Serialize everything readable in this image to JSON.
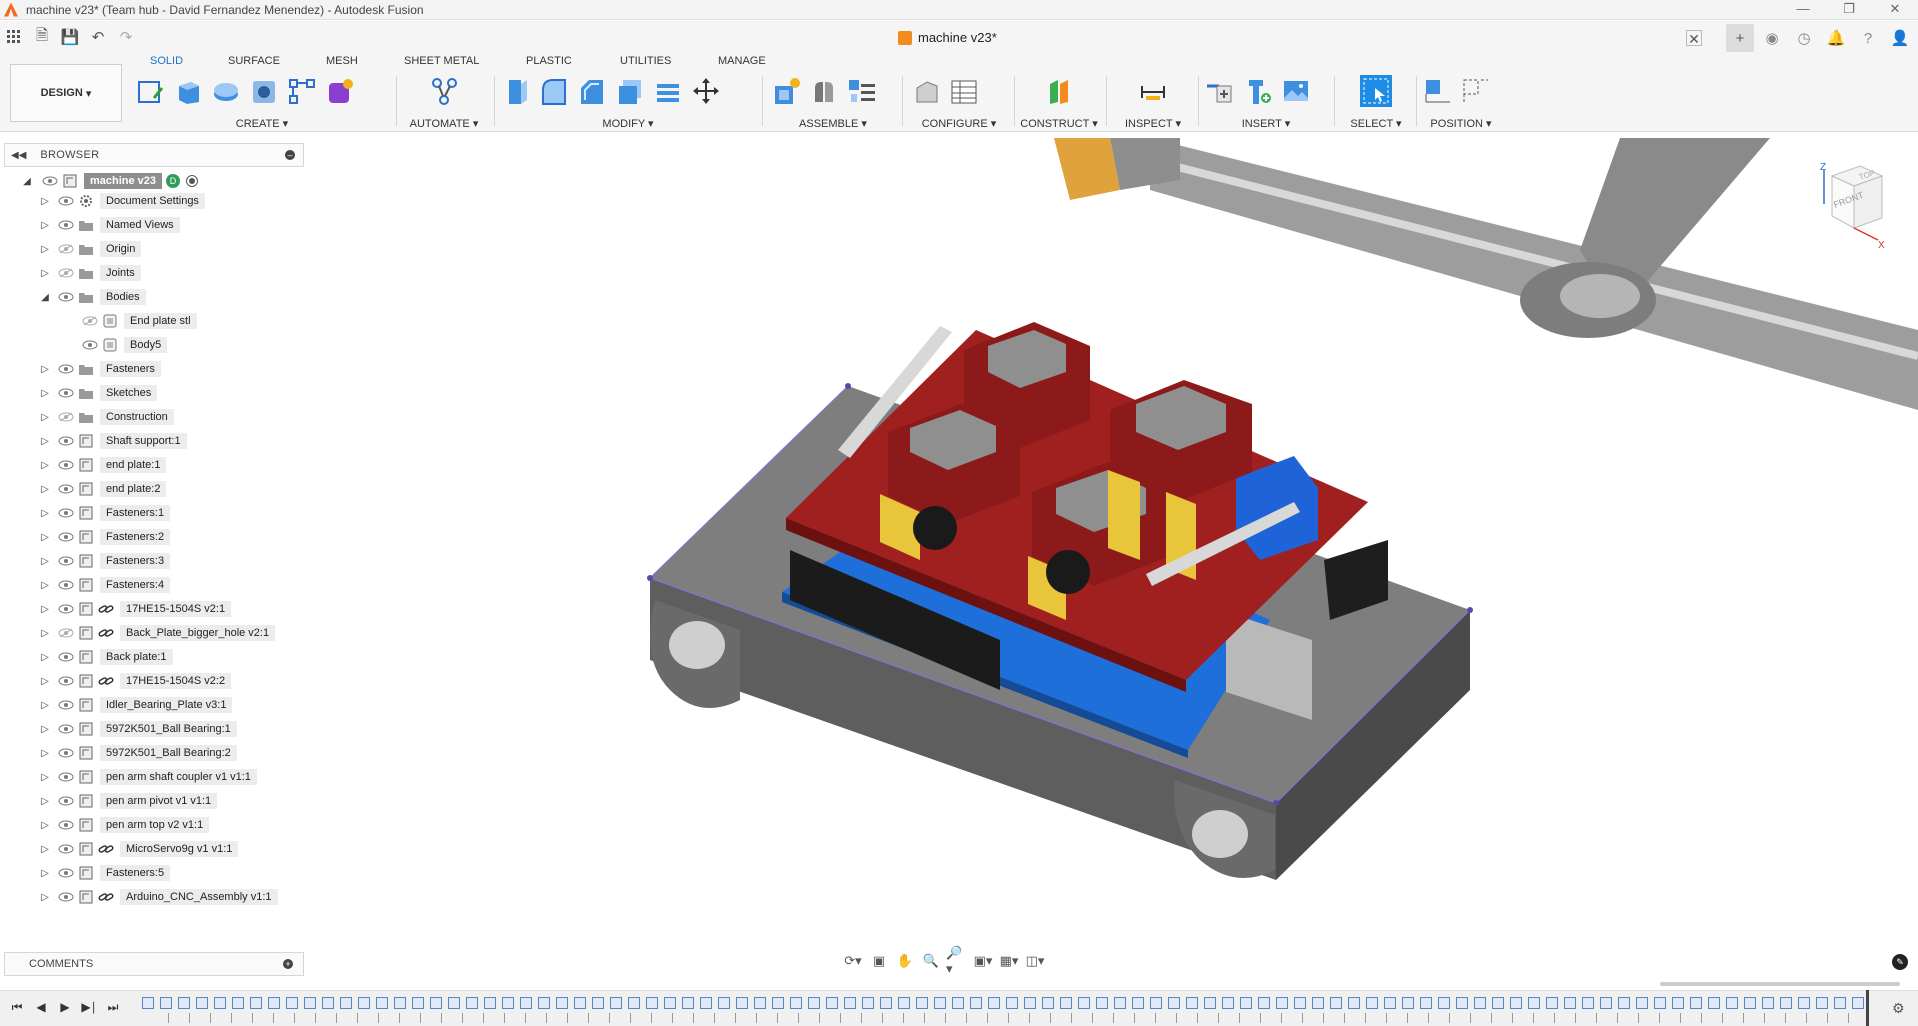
{
  "window": {
    "title": "machine v23* (Team hub - David Fernandez Menendez) - Autodesk Fusion",
    "controls": [
      "minimize",
      "restore",
      "close"
    ]
  },
  "document_tab": {
    "name": "machine v23*"
  },
  "workspace": {
    "label": "DESIGN"
  },
  "ribbon_tabs": [
    {
      "label": "SOLID",
      "active": true
    },
    {
      "label": "SURFACE",
      "active": false
    },
    {
      "label": "MESH",
      "active": false
    },
    {
      "label": "SHEET METAL",
      "active": false
    },
    {
      "label": "PLASTIC",
      "active": false
    },
    {
      "label": "UTILITIES",
      "active": false
    },
    {
      "label": "MANAGE",
      "active": false
    }
  ],
  "ribbon_groups": {
    "create": "CREATE",
    "automate": "AUTOMATE",
    "modify": "MODIFY",
    "assemble": "ASSEMBLE",
    "configure": "CONFIGURE",
    "construct": "CONSTRUCT",
    "inspect": "INSPECT",
    "insert": "INSERT",
    "select": "SELECT",
    "position": "POSITION"
  },
  "browser": {
    "header": "BROWSER",
    "root": "machine v23",
    "items": [
      {
        "label": "Document Settings",
        "type": "settings",
        "expanded": false,
        "hidden": false
      },
      {
        "label": "Named Views",
        "type": "folder",
        "expanded": false,
        "hidden": false
      },
      {
        "label": "Origin",
        "type": "folder",
        "expanded": false,
        "hidden": true
      },
      {
        "label": "Joints",
        "type": "folder",
        "expanded": false,
        "hidden": true
      },
      {
        "label": "Bodies",
        "type": "folder",
        "expanded": true,
        "hidden": false
      },
      {
        "label": "End plate stl",
        "type": "body",
        "child": true,
        "hidden": true
      },
      {
        "label": "Body5",
        "type": "body",
        "child": true,
        "hidden": false
      },
      {
        "label": "Fasteners",
        "type": "folder",
        "expanded": false,
        "hidden": false
      },
      {
        "label": "Sketches",
        "type": "folder",
        "expanded": false,
        "hidden": false
      },
      {
        "label": "Construction",
        "type": "folder",
        "expanded": false,
        "hidden": true
      },
      {
        "label": "Shaft support:1",
        "type": "component",
        "expanded": false,
        "hidden": false
      },
      {
        "label": "end plate:1",
        "type": "component",
        "expanded": false,
        "hidden": false
      },
      {
        "label": "end plate:2",
        "type": "component",
        "expanded": false,
        "hidden": false
      },
      {
        "label": "Fasteners:1",
        "type": "component",
        "expanded": false,
        "hidden": false
      },
      {
        "label": "Fasteners:2",
        "type": "component",
        "expanded": false,
        "hidden": false
      },
      {
        "label": "Fasteners:3",
        "type": "component",
        "expanded": false,
        "hidden": false
      },
      {
        "label": "Fasteners:4",
        "type": "component",
        "expanded": false,
        "hidden": false
      },
      {
        "label": "17HE15-1504S v2:1",
        "type": "linked",
        "expanded": false,
        "hidden": false
      },
      {
        "label": "Back_Plate_bigger_hole v2:1",
        "type": "linked",
        "expanded": false,
        "hidden": true
      },
      {
        "label": "Back plate:1",
        "type": "component",
        "expanded": false,
        "hidden": false
      },
      {
        "label": "17HE15-1504S v2:2",
        "type": "linked",
        "expanded": false,
        "hidden": false
      },
      {
        "label": "Idler_Bearing_Plate v3:1",
        "type": "component",
        "expanded": false,
        "hidden": false
      },
      {
        "label": "5972K501_Ball Bearing:1",
        "type": "component",
        "expanded": false,
        "hidden": false
      },
      {
        "label": "5972K501_Ball Bearing:2",
        "type": "component",
        "expanded": false,
        "hidden": false
      },
      {
        "label": "pen arm shaft coupler v1 v1:1",
        "type": "component",
        "expanded": false,
        "hidden": false
      },
      {
        "label": "pen arm pivot v1 v1:1",
        "type": "component",
        "expanded": false,
        "hidden": false
      },
      {
        "label": "pen arm top v2 v1:1",
        "type": "component",
        "expanded": false,
        "hidden": false
      },
      {
        "label": "MicroServo9g v1 v1:1",
        "type": "linked",
        "expanded": false,
        "hidden": false
      },
      {
        "label": "Fasteners:5",
        "type": "component",
        "expanded": false,
        "hidden": false
      },
      {
        "label": "Arduino_CNC_Assembly v1:1",
        "type": "linked",
        "expanded": false,
        "hidden": false
      }
    ]
  },
  "comments": {
    "label": "COMMENTS"
  },
  "viewcube": {
    "top": "TOP",
    "front": "FRONT",
    "x": "X",
    "z": "Z"
  },
  "colors": {
    "accent": "#1a73c8",
    "root_node": "#8e8e8e",
    "pcb_red": "#8f1b1b",
    "arduino_blue": "#1e6fd9",
    "base_plate": "#6e6e6e"
  }
}
